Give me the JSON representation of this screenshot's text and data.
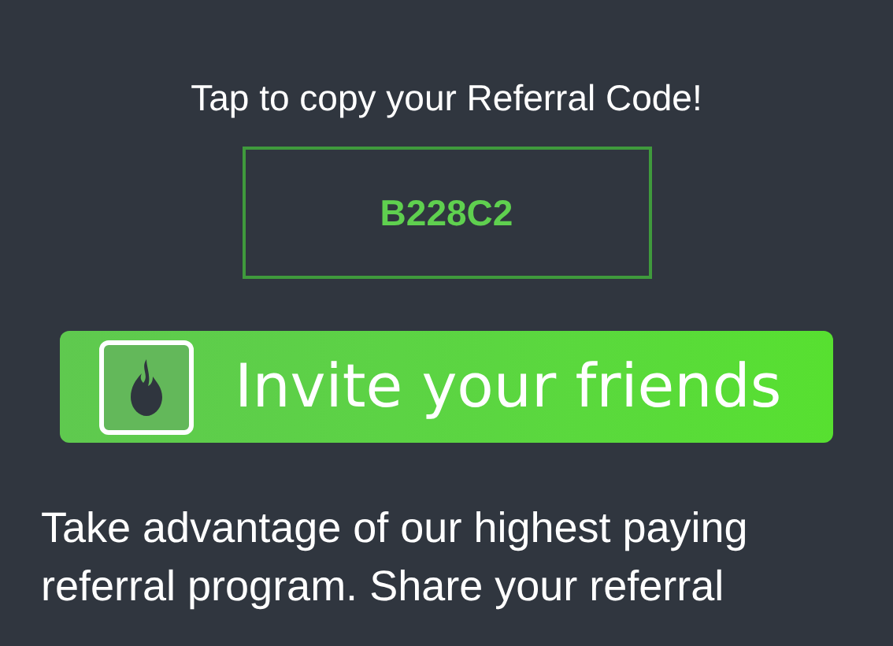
{
  "copy_prompt": "Tap to copy your Referral Code!",
  "referral_code": "B228C2",
  "invite_button": {
    "label": "Invite your friends"
  },
  "description": "Take advantage of our highest paying referral program. Share your referral"
}
